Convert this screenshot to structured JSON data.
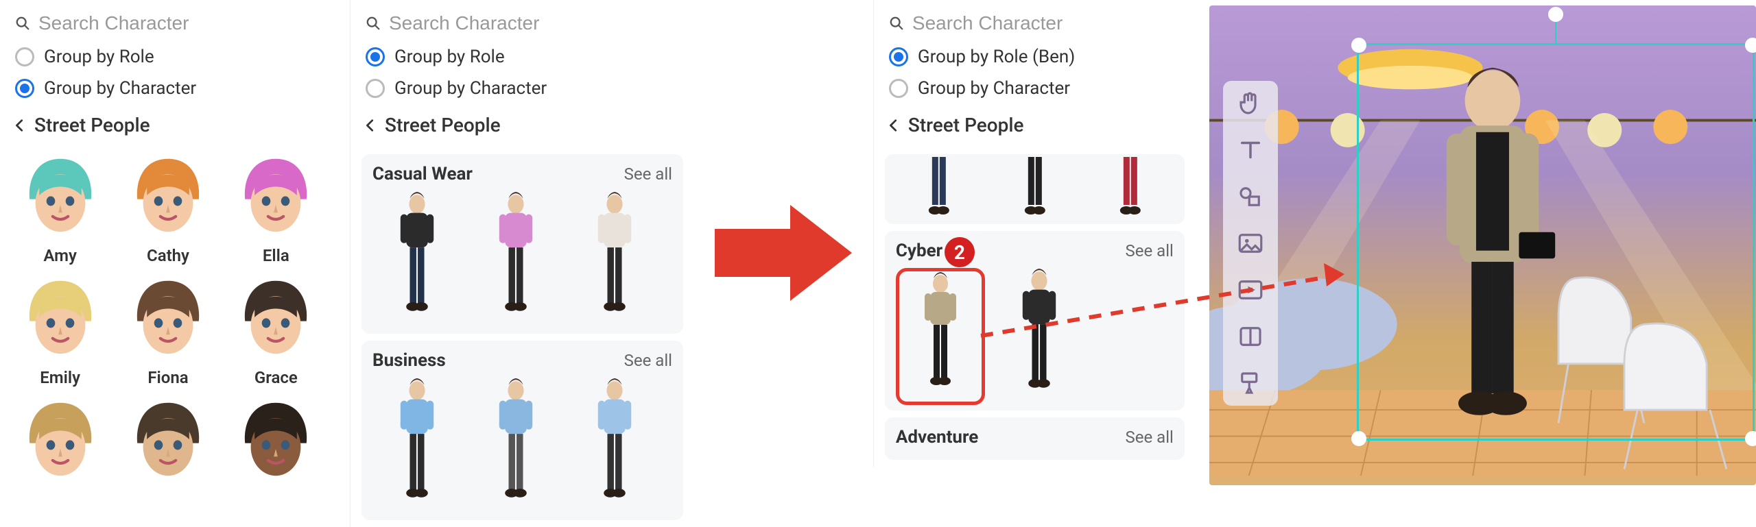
{
  "search_placeholder": "Search Character",
  "group_role": "Group by Role",
  "group_role_ben": "Group by Role (Ben)",
  "group_char": "Group by Character",
  "back_label": "Street People",
  "see_all": "See all",
  "panelA": {
    "characters": [
      {
        "name": "Amy",
        "hair": "#5cc7bb",
        "skin": "#f3c9a6"
      },
      {
        "name": "Cathy",
        "hair": "#e38a3a",
        "skin": "#f3c9a6"
      },
      {
        "name": "Ella",
        "hair": "#d869c9",
        "skin": "#f3c9a6"
      },
      {
        "name": "Emily",
        "hair": "#e7cf7a",
        "skin": "#f3c9a6"
      },
      {
        "name": "Fiona",
        "hair": "#6b4a33",
        "skin": "#f3c9a6"
      },
      {
        "name": "Grace",
        "hair": "#3d3028",
        "skin": "#f3c9a6"
      },
      {
        "name": "",
        "hair": "#c7a05b",
        "skin": "#f3c9a6"
      },
      {
        "name": "",
        "hair": "#4a3a2c",
        "skin": "#e0b68c"
      },
      {
        "name": "",
        "hair": "#2a211b",
        "skin": "#8a5b3c"
      }
    ]
  },
  "panelB": {
    "categories": [
      {
        "title": "Casual Wear",
        "outfits": [
          {
            "top": "#2b2b2b",
            "bottom": "#23324a"
          },
          {
            "top": "#d78ad0",
            "bottom": "#2c2c2c"
          },
          {
            "top": "#e8e2da",
            "bottom": "#2c2c2c"
          }
        ]
      },
      {
        "title": "Business",
        "outfits": [
          {
            "top": "#7fb6e4",
            "bottom": "#2c2c2c"
          },
          {
            "top": "#8ab7df",
            "bottom": "#555"
          },
          {
            "top": "#9dc3e6",
            "bottom": "#333"
          }
        ]
      }
    ]
  },
  "panelC": {
    "legs_row": [
      {
        "bottom": "#2b3a58"
      },
      {
        "bottom": "#222"
      },
      {
        "bottom": "#b02a3a"
      }
    ],
    "categories": [
      {
        "title": "Cyber",
        "outfits": [
          {
            "top": "#b7a887",
            "bottom": "#1e1e1e",
            "selected": true
          },
          {
            "top": "#2b2b2b",
            "bottom": "#1e1e1e"
          }
        ]
      },
      {
        "title": "Adventure",
        "outfits": []
      }
    ]
  },
  "badge_number": "2",
  "canvas_character": {
    "coat": "#b7a887",
    "pants": "#1e1e1e",
    "hair": "#4a3328"
  }
}
